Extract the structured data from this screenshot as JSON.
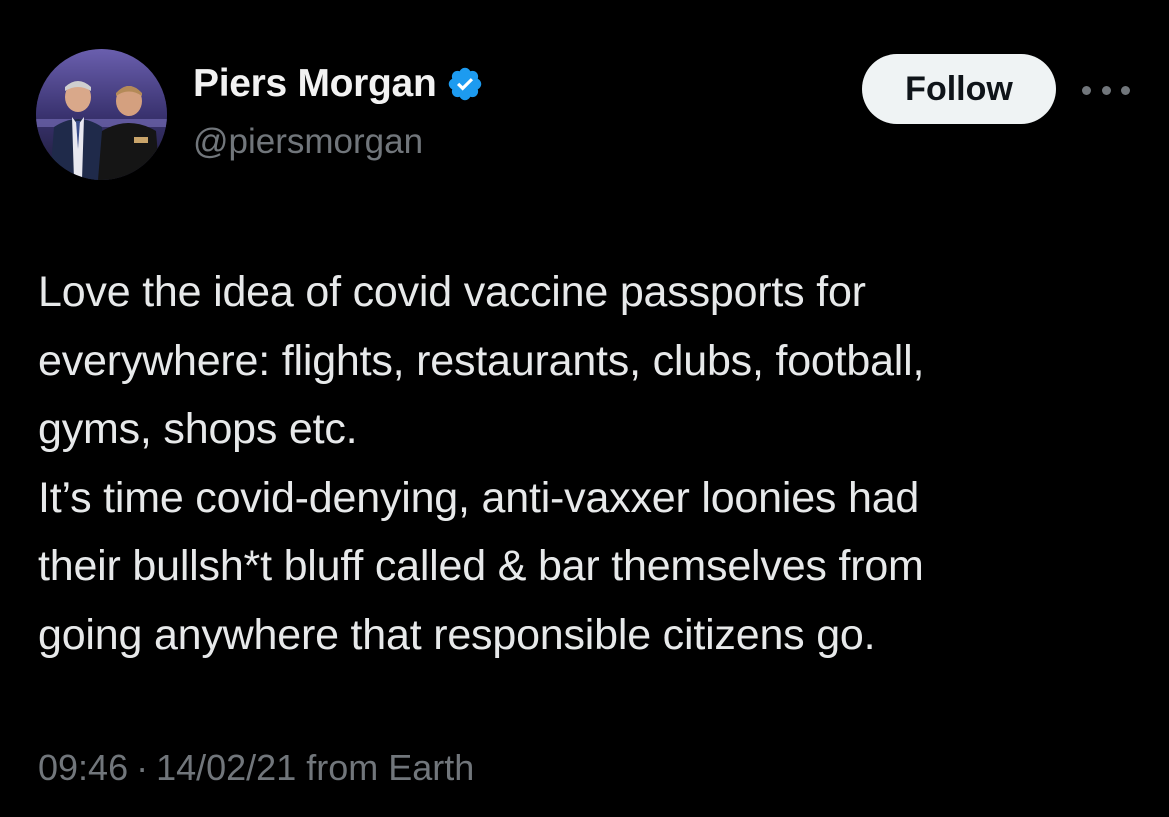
{
  "author": {
    "display_name": "Piers Morgan",
    "handle": "@piersmorgan",
    "verified": true,
    "verified_color": "#1d9bf0",
    "avatar_icon": "profile-photo"
  },
  "actions": {
    "follow_label": "Follow",
    "more_icon": "more-horizontal-icon"
  },
  "tweet": {
    "lines": [
      "Love the idea of covid vaccine passports for",
      "everywhere: flights, restaurants, clubs, football,",
      "gyms, shops etc.",
      "It’s time covid-denying, anti-vaxxer loonies had",
      "their bullsh*t bluff called & bar themselves from",
      "going anywhere that responsible citizens go."
    ]
  },
  "meta": {
    "time": "09:46",
    "separator": "·",
    "date": "14/02/21",
    "source": "from Earth"
  },
  "colors": {
    "background": "#000000",
    "text_primary": "#e7e9ea",
    "text_secondary": "#71767b",
    "button_bg": "#eff3f4",
    "button_text": "#0f1419"
  }
}
